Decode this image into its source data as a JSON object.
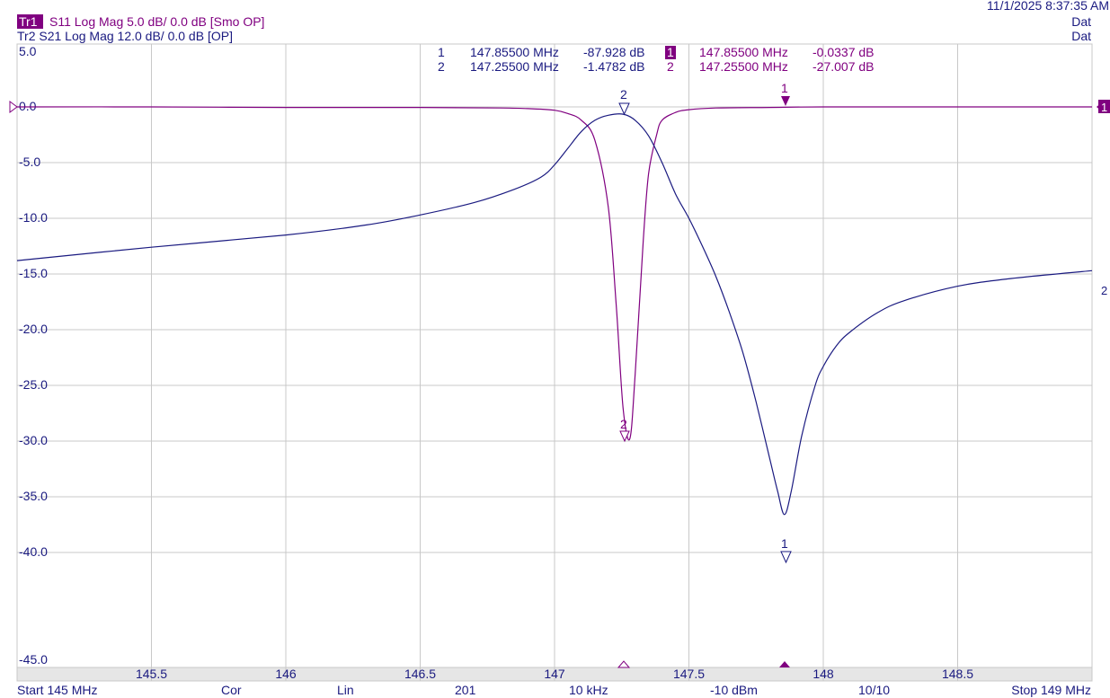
{
  "header": {
    "timestamp": "11/1/2025 8:37:35 AM",
    "tr1_tag": "Tr1",
    "tr1_text": "S11 Log Mag 5.0 dB/ 0.0 dB [Smo OP]",
    "tr2_text": "Tr2 S21 Log Mag 12.0 dB/ 0.0 dB [OP]",
    "tr1_status": "Dat",
    "tr2_status": "Dat"
  },
  "markers": {
    "table_tr2": [
      {
        "id": "1",
        "freq": "147.85500 MHz",
        "value": "-87.928 dB"
      },
      {
        "id": "2",
        "freq": "147.25500 MHz",
        "value": "-1.4782 dB"
      }
    ],
    "table_tr1": [
      {
        "id": "1",
        "freq": "147.85500 MHz",
        "value": "-0.0337 dB"
      },
      {
        "id": "2",
        "freq": "147.25500 MHz",
        "value": "-27.007 dB"
      }
    ],
    "on_trace_labels": [
      "1",
      "2",
      "2",
      "1"
    ],
    "right_edge_labels": {
      "tr1": "1",
      "tr2": "2"
    }
  },
  "footer": {
    "start": "Start 145 MHz",
    "cor": "Cor",
    "sweep_type": "Lin",
    "points": "201",
    "ifbw": "10 kHz",
    "power": "-10 dBm",
    "avg": "10/10",
    "stop": "Stop 149 MHz"
  },
  "colors": {
    "tr1": "#800080",
    "tr2": "#1a1a80",
    "grid": "#c8c8c8",
    "text": "#1a1a80"
  },
  "chart_data": {
    "type": "line",
    "x_range": [
      145,
      149
    ],
    "ylim": [
      -45,
      5
    ],
    "x_tick_labels": [
      "145.5",
      "146",
      "146.5",
      "147",
      "147.5",
      "148",
      "148.5"
    ],
    "x_ticks": [
      145.5,
      146,
      146.5,
      147,
      147.5,
      148,
      148.5
    ],
    "y_tick_labels": [
      "5.0",
      "0.0",
      "-5.0",
      "-10.0",
      "-15.0",
      "-20.0",
      "-25.0",
      "-30.0",
      "-35.0",
      "-40.0",
      "-45.0"
    ],
    "y_ticks": [
      5,
      0,
      -5,
      -10,
      -15,
      -20,
      -25,
      -30,
      -35,
      -40,
      -45
    ],
    "grid": true,
    "series": [
      {
        "name": "S11",
        "x": [
          145.0,
          145.5,
          146.0,
          146.5,
          146.8,
          146.9,
          147.0,
          147.05,
          147.1,
          147.15,
          147.2,
          147.23,
          147.255,
          147.28,
          147.3,
          147.33,
          147.35,
          147.38,
          147.4,
          147.45,
          147.5,
          147.6,
          147.8,
          148.0,
          148.5,
          149.0
        ],
        "y": [
          0.0,
          0.0,
          -0.05,
          -0.05,
          -0.1,
          -0.15,
          -0.3,
          -0.6,
          -1.2,
          -3.0,
          -9.0,
          -18.0,
          -27.0,
          -29.8,
          -24.0,
          -12.0,
          -6.0,
          -2.5,
          -1.2,
          -0.5,
          -0.25,
          -0.1,
          -0.05,
          0.0,
          0.0,
          0.0
        ]
      },
      {
        "name": "S21",
        "x": [
          145.0,
          145.5,
          146.0,
          146.3,
          146.5,
          146.7,
          146.85,
          146.95,
          147.0,
          147.05,
          147.1,
          147.15,
          147.2,
          147.255,
          147.3,
          147.35,
          147.4,
          147.45,
          147.5,
          147.55,
          147.6,
          147.65,
          147.7,
          147.75,
          147.8,
          147.83,
          147.855,
          147.88,
          147.92,
          147.97,
          148.0,
          148.05,
          148.1,
          148.2,
          148.3,
          148.5,
          148.7,
          149.0
        ],
        "y": [
          -13.8,
          -12.6,
          -11.5,
          -10.6,
          -9.7,
          -8.6,
          -7.4,
          -6.3,
          -5.2,
          -3.7,
          -2.2,
          -1.2,
          -0.75,
          -0.65,
          -1.2,
          -2.6,
          -5.0,
          -7.8,
          -10.0,
          -12.5,
          -15.2,
          -18.4,
          -22.0,
          -26.5,
          -31.5,
          -34.5,
          -36.6,
          -34.6,
          -29.5,
          -25.0,
          -23.3,
          -21.4,
          -20.2,
          -18.5,
          -17.4,
          -16.1,
          -15.4,
          -14.7
        ]
      }
    ]
  }
}
